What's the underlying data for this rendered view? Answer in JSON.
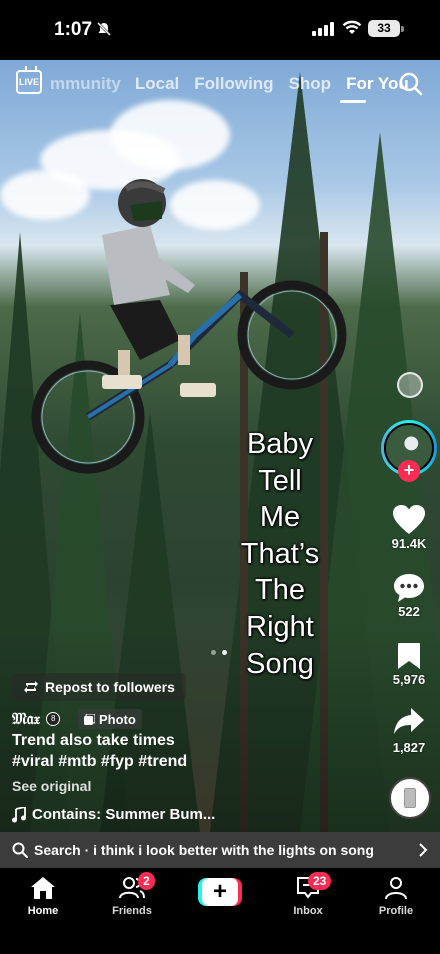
{
  "status_bar": {
    "time": "1:07",
    "battery": "33"
  },
  "top_nav": {
    "live_label": "LIVE",
    "tabs": [
      "mmunity",
      "Local",
      "Following",
      "Shop",
      "For You"
    ],
    "active_tab": "For You"
  },
  "post": {
    "overlay_lines": [
      "Baby",
      "Tell",
      "Me",
      "That’s",
      "The",
      "Right",
      "Song"
    ],
    "likes": "91.4K",
    "comments": "522",
    "saves": "5,976",
    "shares": "1,827",
    "repost_label": "Repost to followers",
    "author": "𝔐𝔞𝔵",
    "author_badge": "8",
    "photo_badge": "Photo",
    "caption": "Trend also take times",
    "hashtags": "#viral #mtb #fyp #trend",
    "see_original": "See original",
    "sound": "Contains: Summer Bum..."
  },
  "search_bar": {
    "text": "Search · i think i look better with the lights on song"
  },
  "bottom_nav": {
    "home": "Home",
    "friends": "Friends",
    "friends_badge": "2",
    "inbox": "Inbox",
    "inbox_badge": "23",
    "profile": "Profile",
    "create_symbol": "+"
  },
  "colors": {
    "accent": "#fe2c55",
    "cyan": "#25f4ee",
    "background": "#000000"
  }
}
